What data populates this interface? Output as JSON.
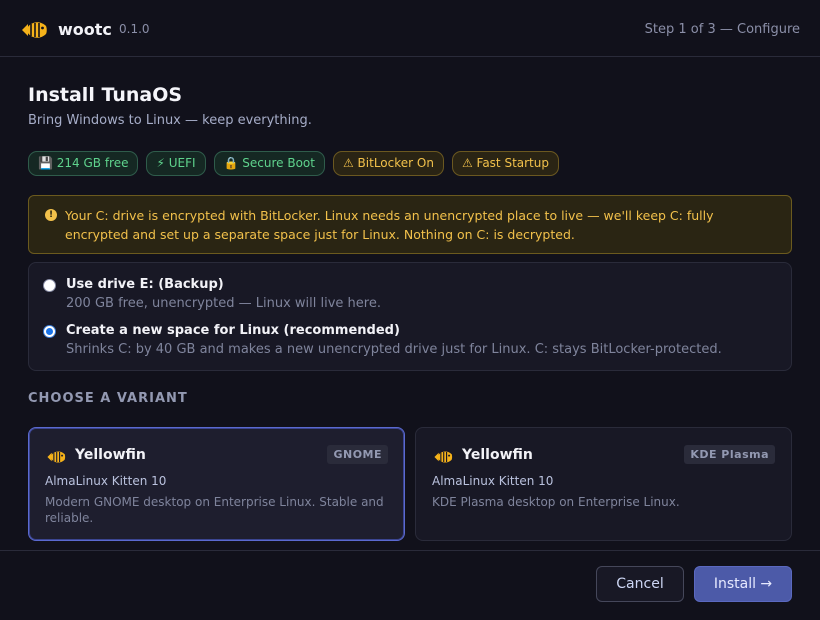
{
  "header": {
    "app_name": "wootc",
    "version": "0.1.0",
    "step": "Step 1 of 3 — Configure"
  },
  "page": {
    "title": "Install TunaOS",
    "subtitle": "Bring Windows to Linux — keep everything."
  },
  "badges": [
    {
      "label": "💾 214 GB free",
      "status": "ok"
    },
    {
      "label": "⚡ UEFI",
      "status": "ok"
    },
    {
      "label": "🔒 Secure Boot",
      "status": "ok"
    },
    {
      "label": "⚠ BitLocker On",
      "status": "warning"
    },
    {
      "label": "⚠ Fast Startup",
      "status": "warning"
    }
  ],
  "alert": {
    "icon": "warning-icon",
    "text": "Your C: drive is encrypted with BitLocker. Linux needs an unencrypted place to live — we'll keep C: fully encrypted and set up a separate space just for Linux. Nothing on C: is decrypted."
  },
  "install_options": [
    {
      "title": "Use drive E: (Backup)",
      "description": "200 GB free, unencrypted — Linux will live here.",
      "selected": false
    },
    {
      "title": "Create a new space for Linux (recommended)",
      "description": "Shrinks C: by 40 GB and makes a new unencrypted drive just for Linux. C: stays BitLocker-protected.",
      "selected": true
    }
  ],
  "variants": {
    "section_label": "CHOOSE A VARIANT",
    "items": [
      {
        "name": "Yellowfin",
        "tag": "GNOME",
        "base": "AlmaLinux Kitten 10",
        "description": "Modern GNOME desktop on Enterprise Linux. Stable and reliable.",
        "selected": true
      },
      {
        "name": "Yellowfin",
        "tag": "KDE Plasma",
        "base": "AlmaLinux Kitten 10",
        "description": "KDE Plasma desktop on Enterprise Linux.",
        "selected": false
      }
    ]
  },
  "footer": {
    "cancel_label": "Cancel",
    "install_label": "Install →"
  },
  "colors": {
    "background": "#11111b",
    "accent": "#4c5aa8",
    "ok": "#5fd38d",
    "warning": "#f2c14b",
    "logo_yellow": "#f5b21a"
  }
}
